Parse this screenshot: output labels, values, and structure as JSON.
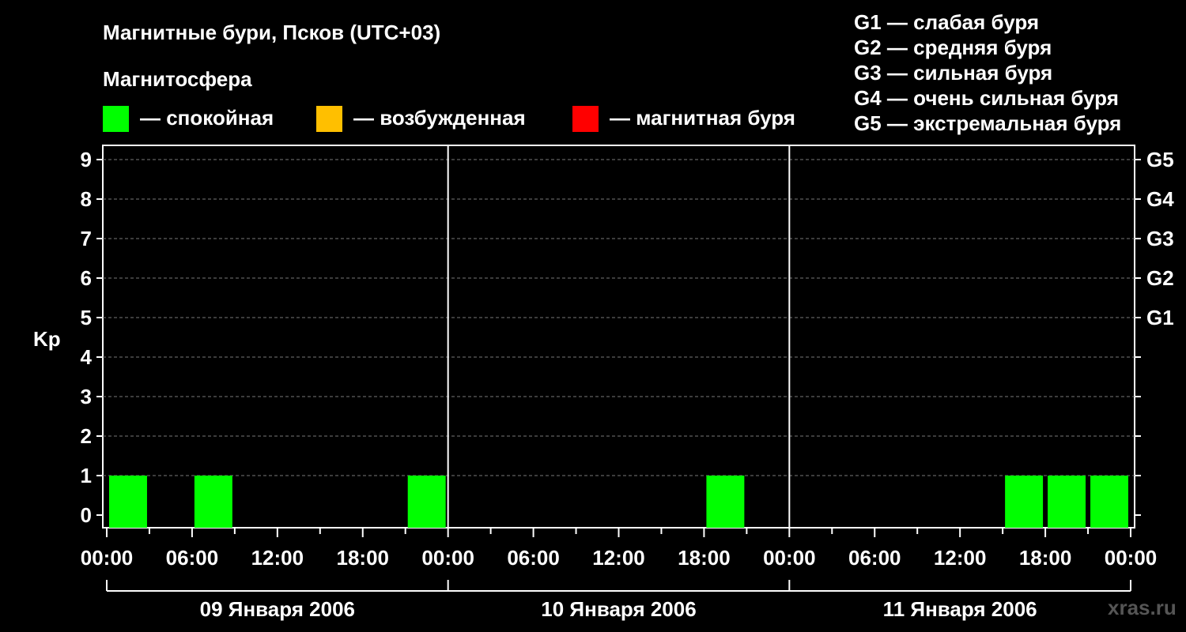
{
  "title": "Магнитные бури, Псков (UTC+03)",
  "magnetosphere_heading": "Магнитосфера",
  "legend": [
    {
      "color": "#00ff00",
      "label": "— спокойная"
    },
    {
      "color": "#ffbf00",
      "label": "— возбужденная"
    },
    {
      "color": "#ff0000",
      "label": "— магнитная буря"
    }
  ],
  "storm_scale": [
    "G1 — слабая буря",
    "G2 — средняя буря",
    "G3 — сильная буря",
    "G4 — очень сильная буря",
    "G5 — экстремальная буря"
  ],
  "watermark": "xras.ru",
  "chart_data": {
    "type": "bar",
    "ylabel": "Kp",
    "ylim": [
      0,
      9
    ],
    "yticks": [
      "0",
      "1",
      "2",
      "3",
      "4",
      "5",
      "6",
      "7",
      "8",
      "9"
    ],
    "right_axis_labels": [
      {
        "kp": 5,
        "label": "G1"
      },
      {
        "kp": 6,
        "label": "G2"
      },
      {
        "kp": 7,
        "label": "G3"
      },
      {
        "kp": 8,
        "label": "G4"
      },
      {
        "kp": 9,
        "label": "G5"
      }
    ],
    "xticks": [
      "00:00",
      "06:00",
      "12:00",
      "18:00",
      "00:00",
      "06:00",
      "12:00",
      "18:00",
      "00:00",
      "06:00",
      "12:00",
      "18:00",
      "00:00"
    ],
    "days": [
      "09 Января 2006",
      "10 Января 2006",
      "11 Января 2006"
    ],
    "grid": true,
    "interval_hours": 3,
    "bars": [
      {
        "day": 0,
        "start_hour": 0,
        "kp": 1,
        "color": "#00ff00"
      },
      {
        "day": 0,
        "start_hour": 6,
        "kp": 1,
        "color": "#00ff00"
      },
      {
        "day": 0,
        "start_hour": 21,
        "kp": 1,
        "color": "#00ff00"
      },
      {
        "day": 1,
        "start_hour": 18,
        "kp": 1,
        "color": "#00ff00"
      },
      {
        "day": 2,
        "start_hour": 15,
        "kp": 1,
        "color": "#00ff00"
      },
      {
        "day": 2,
        "start_hour": 18,
        "kp": 1,
        "color": "#00ff00"
      },
      {
        "day": 2,
        "start_hour": 21,
        "kp": 1,
        "color": "#00ff00"
      }
    ]
  }
}
